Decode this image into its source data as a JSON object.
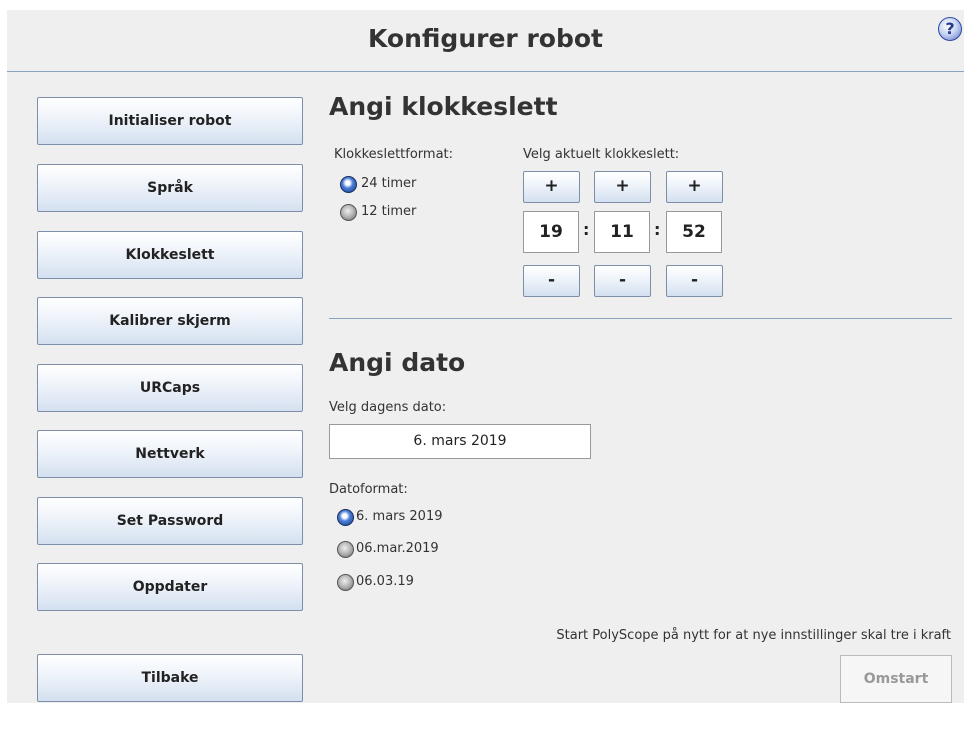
{
  "header": {
    "title": "Konfigurer robot",
    "help_icon": "?"
  },
  "nav": {
    "items": [
      {
        "label": "Initialiser robot"
      },
      {
        "label": "Språk"
      },
      {
        "label": "Klokkeslett"
      },
      {
        "label": "Kalibrer skjerm"
      },
      {
        "label": "URCaps"
      },
      {
        "label": "Nettverk"
      },
      {
        "label": "Set Password"
      },
      {
        "label": "Oppdater"
      }
    ],
    "back_label": "Tilbake"
  },
  "time": {
    "heading": "Angi klokkeslett",
    "format_label": "Klokkeslettformat:",
    "formats": [
      {
        "label": "24 timer",
        "selected": true
      },
      {
        "label": "12 timer",
        "selected": false
      }
    ],
    "current_label": "Velg aktuelt klokkeslett:",
    "hours": "19",
    "minutes": "11",
    "seconds": "52",
    "plus": "+",
    "minus": "-",
    "separator": ":"
  },
  "date": {
    "heading": "Angi dato",
    "today_label": "Velg dagens dato:",
    "value": "6. mars 2019",
    "format_label": "Datoformat:",
    "formats": [
      {
        "label": "6. mars 2019",
        "selected": true
      },
      {
        "label": "06.mar.2019",
        "selected": false
      },
      {
        "label": "06.03.19",
        "selected": false
      }
    ]
  },
  "footer": {
    "note": "Start PolyScope på nytt for at nye innstillinger skal tre i kraft",
    "restart_label": "Omstart"
  },
  "colors": {
    "accent": "#8aa4c0",
    "radio_on": "#2a5cb8"
  }
}
